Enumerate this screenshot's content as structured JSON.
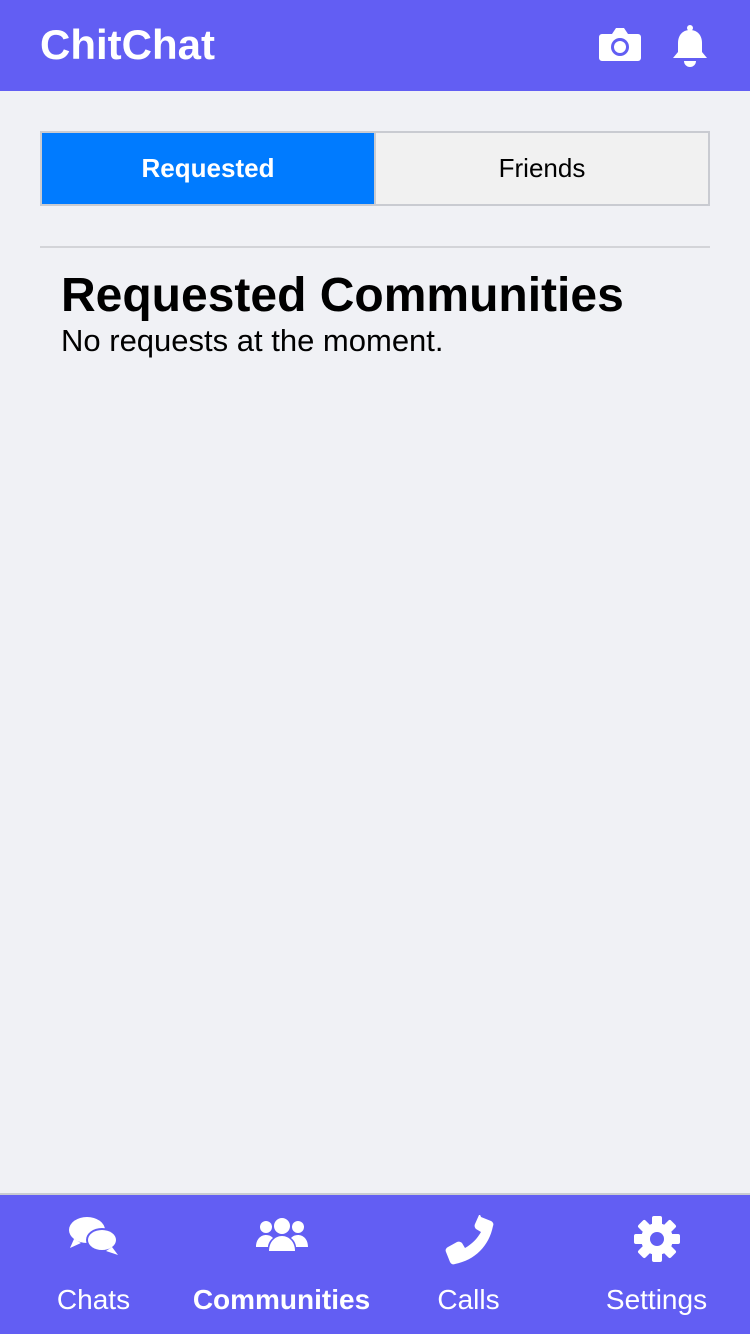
{
  "header": {
    "title": "ChitChat",
    "icons": [
      "camera-icon",
      "bell-icon"
    ]
  },
  "tabs": {
    "items": [
      {
        "label": "Requested",
        "active": true
      },
      {
        "label": "Friends",
        "active": false
      }
    ]
  },
  "main": {
    "section_title": "Requested Communities",
    "empty_message": "No requests at the moment."
  },
  "bottom_nav": {
    "items": [
      {
        "label": "Chats",
        "icon": "chat-bubbles-icon",
        "active": false
      },
      {
        "label": "Communities",
        "icon": "users-icon",
        "active": true
      },
      {
        "label": "Calls",
        "icon": "phone-icon",
        "active": false
      },
      {
        "label": "Settings",
        "icon": "gear-icon",
        "active": false
      }
    ]
  },
  "colors": {
    "brand": "#625ef3",
    "accent": "#007bff",
    "background": "#f0f1f5"
  }
}
